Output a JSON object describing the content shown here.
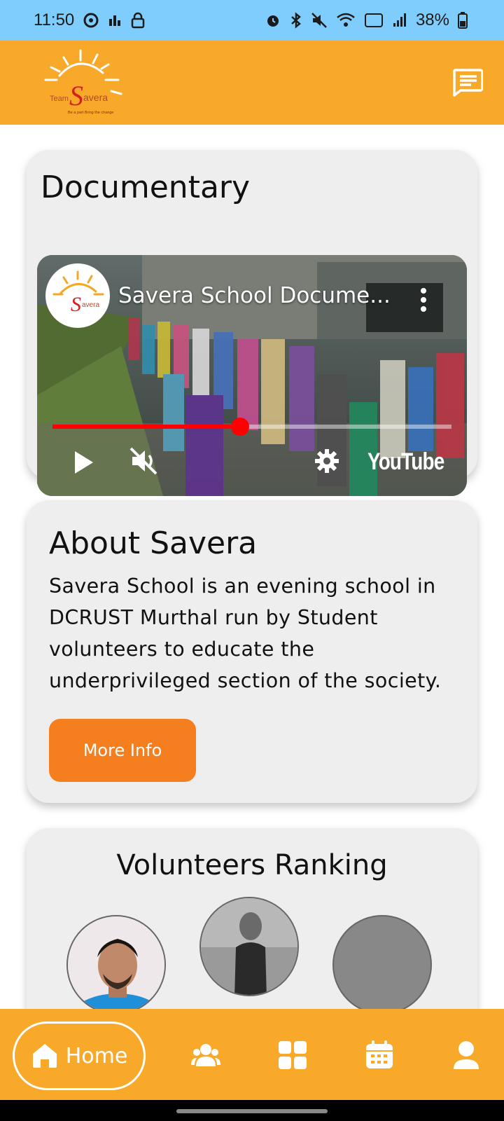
{
  "status_bar": {
    "time": "11:50",
    "battery": "38%"
  },
  "app_bar": {
    "logo_text": "Team Savera",
    "logo_tagline": "Be a part Bring the change"
  },
  "documentary": {
    "title": "Documentary",
    "video_title": "Savera School Docume...",
    "video_brand": "YouTube",
    "progress": 0.47
  },
  "about": {
    "title": "About Savera",
    "text": "Savera School is an evening school in DCRUST Murthal run by Student volunteers to educate the underprivileged section of the society.",
    "button_label": "More Info"
  },
  "ranking": {
    "title": "Volunteers Ranking"
  },
  "bottom_nav": {
    "home_label": "Home"
  },
  "colors": {
    "app_bar": "#f8a92a",
    "status_bar": "#7fcdfc",
    "button": "#f57e1f",
    "progress": "#ff0000"
  }
}
